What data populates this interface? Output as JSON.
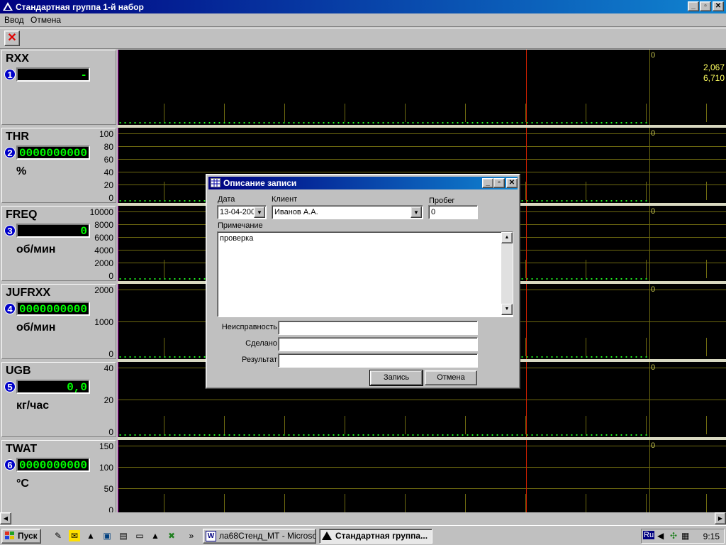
{
  "window": {
    "title": "Стандартная группа 1-й набор",
    "min": "_",
    "max": "▫",
    "close": "✕"
  },
  "menu": {
    "items": [
      "Ввод",
      "Отмена"
    ]
  },
  "toolbar": {
    "stop": "✕"
  },
  "channels": [
    {
      "num": "1",
      "name": "RXX",
      "value": "-",
      "unit": "",
      "ticks": [],
      "right_values": [
        "2,067",
        "6,710"
      ]
    },
    {
      "num": "2",
      "name": "THR",
      "value": "0000000000",
      "unit": "%",
      "ticks": [
        "100",
        "80",
        "60",
        "40",
        "20",
        "0"
      ]
    },
    {
      "num": "3",
      "name": "FREQ",
      "value": "0",
      "unit": "об/мин",
      "ticks": [
        "10000",
        "8000",
        "6000",
        "4000",
        "2000",
        "0"
      ]
    },
    {
      "num": "4",
      "name": "JUFRXX",
      "value": "0000000000",
      "unit": "об/мин",
      "ticks": [
        "2000",
        "1000",
        "0"
      ]
    },
    {
      "num": "5",
      "name": "UGB",
      "value": "0,0",
      "unit": "кг/час",
      "ticks": [
        "40",
        "20",
        "0"
      ]
    },
    {
      "num": "6",
      "name": "TWAT",
      "value": "0000000000",
      "unit": "°C",
      "ticks": [
        "150",
        "100",
        "50",
        "0"
      ]
    }
  ],
  "plot_zero": "0",
  "dialog": {
    "title": "Описание записи",
    "date_label": "Дата",
    "date_value": "13-04-200",
    "client_label": "Клиент",
    "client_value": "Иванов А.А.",
    "mileage_label": "Пробег",
    "mileage_value": "0",
    "note_label": "Примечание",
    "note_value": "проверка",
    "fault_label": "Неисправность",
    "fault_value": "",
    "done_label": "Сделано",
    "done_value": "",
    "result_label": "Результат",
    "result_value": "",
    "save_button": "Запись",
    "cancel_button": "Отмена"
  },
  "taskbar": {
    "start": "Пуск",
    "tasks": [
      "ла68Стенд_МТ - Microsof...",
      "Стандартная группа..."
    ],
    "lang": "Ru",
    "clock": "9:15"
  }
}
